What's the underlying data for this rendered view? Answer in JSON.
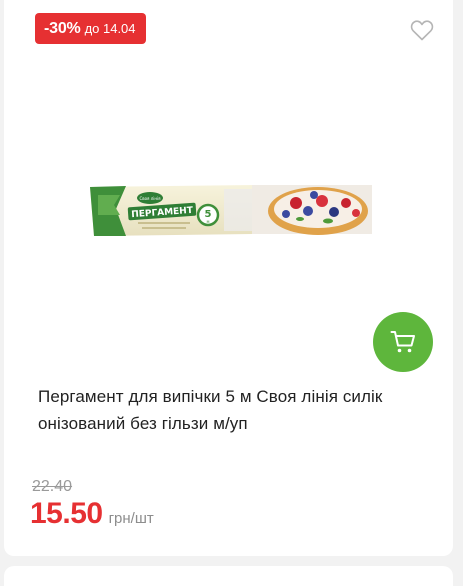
{
  "badge": {
    "discount": "-30%",
    "valid_until": "до 14.04"
  },
  "product": {
    "title": "Пергамент для випічки 5 м Своя лінія силік онізований без гільзи м/уп",
    "old_price": "22.40",
    "price": "15.50",
    "unit": "грн/шт",
    "package": {
      "brand": "Своя лінія",
      "name": "ПЕРГАМЕНТ",
      "length": "5",
      "length_unit": "м"
    }
  },
  "icons": {
    "favorite": "heart-outline-icon",
    "cart": "shopping-cart-icon"
  },
  "colors": {
    "discount": "#e63032",
    "cart_button": "#5eb63c",
    "old_price": "#9a9a9a"
  }
}
